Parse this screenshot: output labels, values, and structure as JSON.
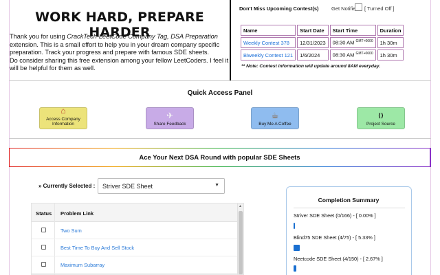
{
  "header": {
    "headline": "WORK HARD, PREPARE HARDER",
    "intro_prefix": "Thank you for using ",
    "intro_em": "CrackTech-LeetCode Company Tag, DSA Preparation",
    "intro_suffix": " extension. This is a small effort to help you in your dream company specific preparation. Track your progress and prepare with famous SDE sheets.",
    "intro_2": "Do consider sharing this free extension among your fellow LeetCoders. I feel it will be helpful for them as well."
  },
  "contests": {
    "title": "Don't Miss Upcoming Contest(s)",
    "get_notified": "Get Notified:",
    "toggle_state": "[ Turned Off ]",
    "columns": [
      "Name",
      "Start Date",
      "Start Time",
      "Duration"
    ],
    "rows": [
      {
        "name": "Weekly Contest 378",
        "date": "12/31/2023",
        "time": "08:30 AM",
        "tz": "GMT+0600",
        "duration": "1h 30m"
      },
      {
        "name": "Biweekly Contest 121",
        "date": "1/6/2024",
        "time": "08:30 AM",
        "tz": "GMT+0600",
        "duration": "1h 30m"
      }
    ],
    "note": "** Note: Contest information will update around 8AM everyday."
  },
  "quick_access": {
    "title": "Quick Access Panel",
    "buttons": [
      {
        "icon": "building-icon",
        "glyph": "⌂",
        "label1": "Access Company",
        "label2": "Information",
        "color": "#ece37a"
      },
      {
        "icon": "paper-plane-icon",
        "glyph": "✈",
        "label1": "Share Feedback",
        "label2": "",
        "color": "#c8abe7"
      },
      {
        "icon": "coffee-icon",
        "glyph": "☕",
        "label1": "Buy Me A Coffee",
        "label2": "",
        "color": "#8fbcef"
      },
      {
        "icon": "code-file-icon",
        "glyph": "⟨⟩",
        "label1": "Project Source",
        "label2": "",
        "color": "#9de8a6"
      }
    ]
  },
  "banner": {
    "text": "Ace Your Next DSA Round with popular SDE Sheets"
  },
  "sheet_select": {
    "label": "» Currently Selected :",
    "value": "Striver SDE Sheet"
  },
  "problems": {
    "columns": [
      "Status",
      "Problem Link"
    ],
    "rows": [
      {
        "name": "Two Sum",
        "done": false
      },
      {
        "name": "Best Time To Buy And Sell Stock",
        "done": false
      },
      {
        "name": "Maximum Subarray",
        "done": false
      }
    ]
  },
  "summary": {
    "title": "Completion Summary",
    "items": [
      {
        "label": "Striver SDE Sheet (0/166) - [ 0.00% ]",
        "fraction": 0.0
      },
      {
        "label": "Blind75 SDE Sheet (4/75) - [ 5.33% ]",
        "fraction": 0.0533
      },
      {
        "label": "Neetcode SDE Sheet (4/150) - [ 2.67% ]",
        "fraction": 0.0267
      }
    ]
  }
}
